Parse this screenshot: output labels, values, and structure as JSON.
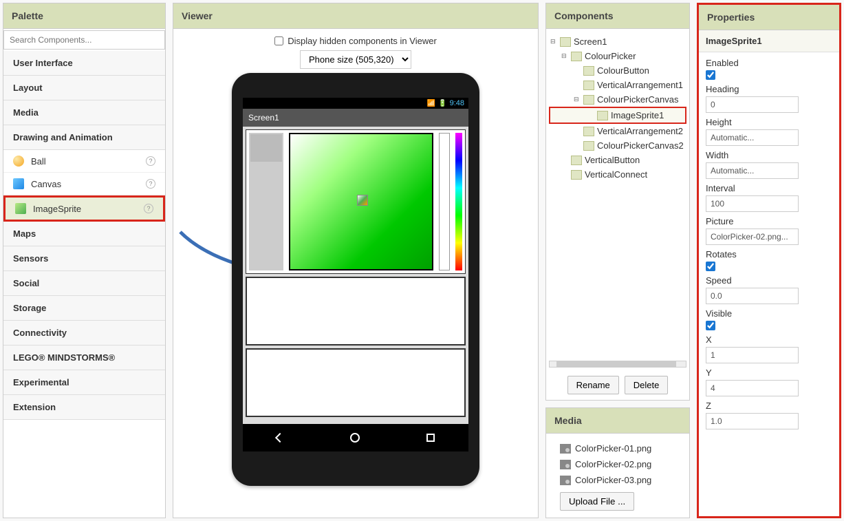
{
  "palette": {
    "header": "Palette",
    "search_placeholder": "Search Components...",
    "categories": {
      "ui": "User Interface",
      "layout": "Layout",
      "media": "Media",
      "drawing": "Drawing and Animation",
      "maps": "Maps",
      "sensors": "Sensors",
      "social": "Social",
      "storage": "Storage",
      "connectivity": "Connectivity",
      "lego": "LEGO® MINDSTORMS®",
      "experimental": "Experimental",
      "extension": "Extension"
    },
    "drawing_items": {
      "ball": "Ball",
      "canvas": "Canvas",
      "imagesprite": "ImageSprite"
    },
    "help_glyph": "?"
  },
  "viewer": {
    "header": "Viewer",
    "show_hidden_label": "Display hidden components in Viewer",
    "size_select": "Phone size (505,320)",
    "statusbar_time": "9:48",
    "screen_title": "Screen1",
    "nav_back_glyph": "◁",
    "nav_home_glyph": "○",
    "nav_recent_glyph": "□"
  },
  "components": {
    "header": "Components",
    "tree": {
      "screen1": "Screen1",
      "colourpicker": "ColourPicker",
      "colourbutton": "ColourButton",
      "va1": "VerticalArrangement1",
      "cpcanvas": "ColourPickerCanvas",
      "imagesprite1": "ImageSprite1",
      "va2": "VerticalArrangement2",
      "cpcanvas2": "ColourPickerCanvas2",
      "vbutton": "VerticalButton",
      "vconnect": "VerticalConnect"
    },
    "rename": "Rename",
    "delete": "Delete"
  },
  "media": {
    "header": "Media",
    "items": {
      "f1": "ColorPicker-01.png",
      "f2": "ColorPicker-02.png",
      "f3": "ColorPicker-03.png"
    },
    "upload": "Upload File ..."
  },
  "properties": {
    "header": "Properties",
    "component_name": "ImageSprite1",
    "fields": {
      "enabled_label": "Enabled",
      "heading_label": "Heading",
      "heading_value": "0",
      "height_label": "Height",
      "height_value": "Automatic...",
      "width_label": "Width",
      "width_value": "Automatic...",
      "interval_label": "Interval",
      "interval_value": "100",
      "picture_label": "Picture",
      "picture_value": "ColorPicker-02.png...",
      "rotates_label": "Rotates",
      "speed_label": "Speed",
      "speed_value": "0.0",
      "visible_label": "Visible",
      "x_label": "X",
      "x_value": "1",
      "y_label": "Y",
      "y_value": "4",
      "z_label": "Z",
      "z_value": "1.0"
    }
  }
}
